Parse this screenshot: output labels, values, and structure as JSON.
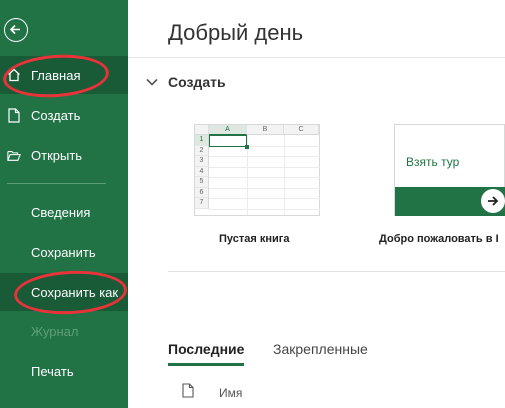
{
  "sidebar": {
    "back_icon": "back-arrow-icon",
    "items": [
      {
        "label": "Главная",
        "icon": "home-icon",
        "active": true
      },
      {
        "label": "Создать",
        "icon": "new-doc-icon"
      },
      {
        "label": "Открыть",
        "icon": "folder-open-icon"
      },
      {
        "label": "Сведения"
      },
      {
        "label": "Сохранить"
      },
      {
        "label": "Сохранить как"
      },
      {
        "label": "Журнал",
        "disabled": true
      },
      {
        "label": "Печать"
      }
    ]
  },
  "main": {
    "greeting": "Добрый день",
    "create_section": {
      "title": "Создать",
      "templates": [
        {
          "label": "Пустая книга",
          "columns": [
            "A",
            "B",
            "C"
          ],
          "rows": [
            "1",
            "2",
            "3",
            "4",
            "5",
            "6",
            "7"
          ]
        },
        {
          "label": "Добро пожаловать в I",
          "tour_text": "Взять тур"
        }
      ]
    },
    "tabs": [
      {
        "label": "Последние",
        "active": true
      },
      {
        "label": "Закрепленные"
      }
    ],
    "recent_list": {
      "column_header": "Имя"
    }
  },
  "colors": {
    "brand_green": "#217346",
    "active_nav": "#195a37",
    "annotation_red": "#e8333a"
  }
}
